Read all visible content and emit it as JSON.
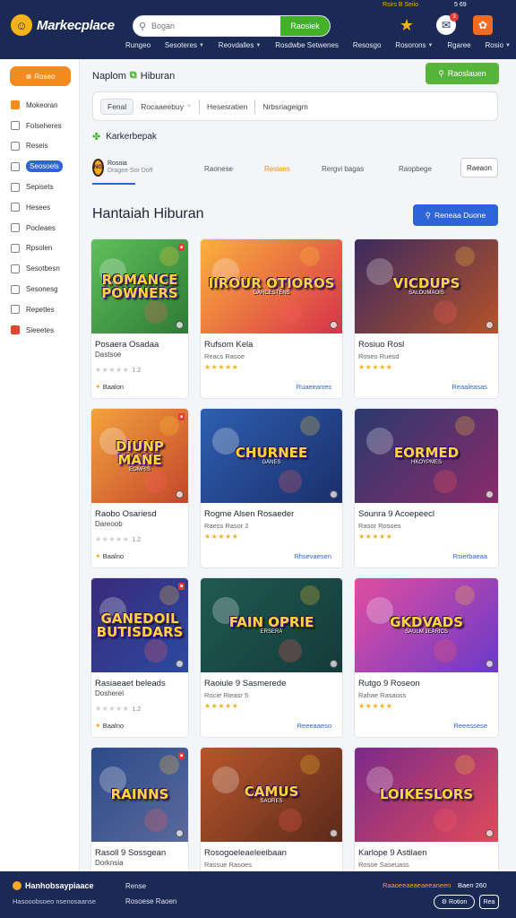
{
  "header": {
    "brand": "Markecplace",
    "search_placeholder": "Bogan",
    "search_button": "Raosiek",
    "top_mini": [
      "Rsirs B Seiio",
      "5 69"
    ],
    "nav": [
      "Rungeo",
      "Sesoteres",
      "Reovdalles",
      "Rosdwbe Setwenes",
      "Resosgo",
      "Rosorons",
      "Rgaree",
      "Rosio"
    ],
    "badge_count": "3"
  },
  "sidebar": {
    "cta_label": "Roseo",
    "items": [
      {
        "label": "Mokeoran",
        "icon": "home-icon",
        "active": false
      },
      {
        "label": "Folseheres",
        "icon": "list-icon",
        "active": false
      },
      {
        "label": "Reseis",
        "icon": "chat-icon",
        "active": false
      },
      {
        "label": "Seosoels",
        "icon": "calendar-icon",
        "active": true
      },
      {
        "label": "Sepisets",
        "icon": "shield-icon",
        "active": false
      },
      {
        "label": "Hesees",
        "icon": "tag-icon",
        "active": false
      },
      {
        "label": "Pocleaes",
        "icon": "doc-icon",
        "active": false
      },
      {
        "label": "Rpsolen",
        "icon": "edit-icon",
        "active": false
      },
      {
        "label": "Sesotbesn",
        "icon": "gift-icon",
        "active": false
      },
      {
        "label": "Sesonesg",
        "icon": "settings-icon",
        "active": false
      },
      {
        "label": "Repetles",
        "icon": "share-icon",
        "active": false
      },
      {
        "label": "Sieeetes",
        "icon": "flag-icon",
        "active": false
      }
    ]
  },
  "main": {
    "breadcrumb": [
      "Naplom",
      "Hiburan"
    ],
    "add_button": "Raoslauen",
    "filters": {
      "chip": "Fenal",
      "select": "Rocaaeebuy",
      "col2": "Hesesratien",
      "col3": "Nrbsriageigm"
    },
    "section_label": "Karkerbepak",
    "tabs": {
      "first_line1": "Rosoia",
      "first_line2": "Dragee Sor Doff",
      "items": [
        "Raonese",
        "Resiaes",
        "Rergvi bagas",
        "Raopbege"
      ],
      "button": "Raeaon"
    },
    "page_title": "Hantaiah Hiburan",
    "title_button": "Reneaa Duone",
    "games": [
      {
        "thumb": "ROMANCE POWNERS",
        "thumb_sub": "",
        "title": "Posaera Osadaa",
        "title2": "Dastsoe",
        "sub": "",
        "rating": 1.2,
        "stars_filled": false,
        "footer": "Baalon",
        "footer_type": "brand",
        "palette": [
          "#5fc05a",
          "#2e7a36"
        ]
      },
      {
        "thumb": "IIROUR OTIOROS",
        "thumb_sub": "GARCESTENS",
        "title": "Rufsom Kela",
        "title2": "",
        "sub": "Reacs Rasoe",
        "rating": 5,
        "stars_filled": true,
        "footer": "Ruaeearres",
        "footer_type": "action",
        "palette": [
          "#f9b13b",
          "#d8324a"
        ]
      },
      {
        "thumb": "VICDUPS",
        "thumb_sub": "SALOUMAOIS",
        "title": "Rosiuo Rosl",
        "title2": "",
        "sub": "Roseo Ruesd",
        "rating": 5,
        "stars_filled": true,
        "footer": "Reaaleasas",
        "footer_type": "action",
        "palette": [
          "#3b2a5e",
          "#b5532a"
        ]
      },
      {
        "thumb": "DIUNP MANE",
        "thumb_sub": "EOMRIS",
        "title": "Raobo Osariesd",
        "title2": "Dareoob",
        "sub": "",
        "rating": 1.2,
        "stars_filled": false,
        "footer": "Baalno",
        "footer_type": "brand",
        "palette": [
          "#f3a33c",
          "#c2462b"
        ]
      },
      {
        "thumb": "CHURNEE",
        "thumb_sub": "GANES",
        "title": "Rogme Alsen Rosaeder",
        "title2": "",
        "sub": "Raess Rasor 2",
        "rating": 5,
        "stars_filled": true,
        "footer": "Rhsevaesen",
        "footer_type": "action",
        "palette": [
          "#2e5fb0",
          "#1a2f6a"
        ]
      },
      {
        "thumb": "EORMED",
        "thumb_sub": "HKOYPMES",
        "title": "Sounra 9 Acoepeecl",
        "title2": "",
        "sub": "Rasor Rosoes",
        "rating": 5,
        "stars_filled": true,
        "footer": "Rsierbaeaa",
        "footer_type": "action",
        "palette": [
          "#2a3a6e",
          "#8a2a6a"
        ]
      },
      {
        "thumb": "GANEDOIL BUTISDARS",
        "thumb_sub": "",
        "title": "Rasiaeaet beleads",
        "title2": "Dosherel",
        "sub": "",
        "rating": 1.2,
        "stars_filled": false,
        "footer": "Baalno",
        "footer_type": "brand",
        "palette": [
          "#3a2a7a",
          "#2a4aa0"
        ]
      },
      {
        "thumb": "FAIN OPRIE",
        "thumb_sub": "ERSERA",
        "title": "Raoiule 9 Sasmerede",
        "title2": "",
        "sub": "Rocie Rieasr 5",
        "rating": 5,
        "stars_filled": true,
        "footer": "Reeeaaeso",
        "footer_type": "action",
        "palette": [
          "#1f5a52",
          "#143a3a"
        ]
      },
      {
        "thumb": "GKDVADS",
        "thumb_sub": "SAULM JEARICS",
        "title": "Rutgo 9 Roseon",
        "title2": "",
        "sub": "Rahae Rasaoss",
        "rating": 5,
        "stars_filled": true,
        "footer": "Reeessese",
        "footer_type": "action",
        "palette": [
          "#e04ea0",
          "#6a3ac8"
        ]
      },
      {
        "thumb": "RAINNS",
        "thumb_sub": "",
        "title": "Rasoll 9 Sossgean",
        "title2": "Dorknsia",
        "sub": "",
        "rating": 0,
        "stars_filled": false,
        "footer": "",
        "footer_type": "none",
        "palette": [
          "#2c4a8a",
          "#5a6a9a"
        ]
      },
      {
        "thumb": "CAMUS",
        "thumb_sub": "SAORES",
        "title": "Rosogoeleaeleeibaan",
        "title2": "",
        "sub": "Rassue Rasoes",
        "rating": 0,
        "stars_filled": false,
        "footer": "",
        "footer_type": "none",
        "palette": [
          "#b8562a",
          "#5a2a1a"
        ]
      },
      {
        "thumb": "LOIKESLORS",
        "thumb_sub": "",
        "title": "Karlope 9 Astilaen",
        "title2": "",
        "sub": "Rosoe Saseuass",
        "rating": 0,
        "stars_filled": false,
        "footer": "",
        "footer_type": "none",
        "palette": [
          "#7a2a8a",
          "#e04a5a"
        ]
      }
    ]
  },
  "footer": {
    "brand": "Hanhobsaypiaace",
    "sub": "Hasooobsoeo nsenosaanse",
    "links": [
      "Rense",
      "Rosoese Raoen"
    ],
    "promo": "Raaoeeaeaeaeeaneen",
    "hint": "Baen 260",
    "pill": "Rotion",
    "pill2": "Rea"
  }
}
